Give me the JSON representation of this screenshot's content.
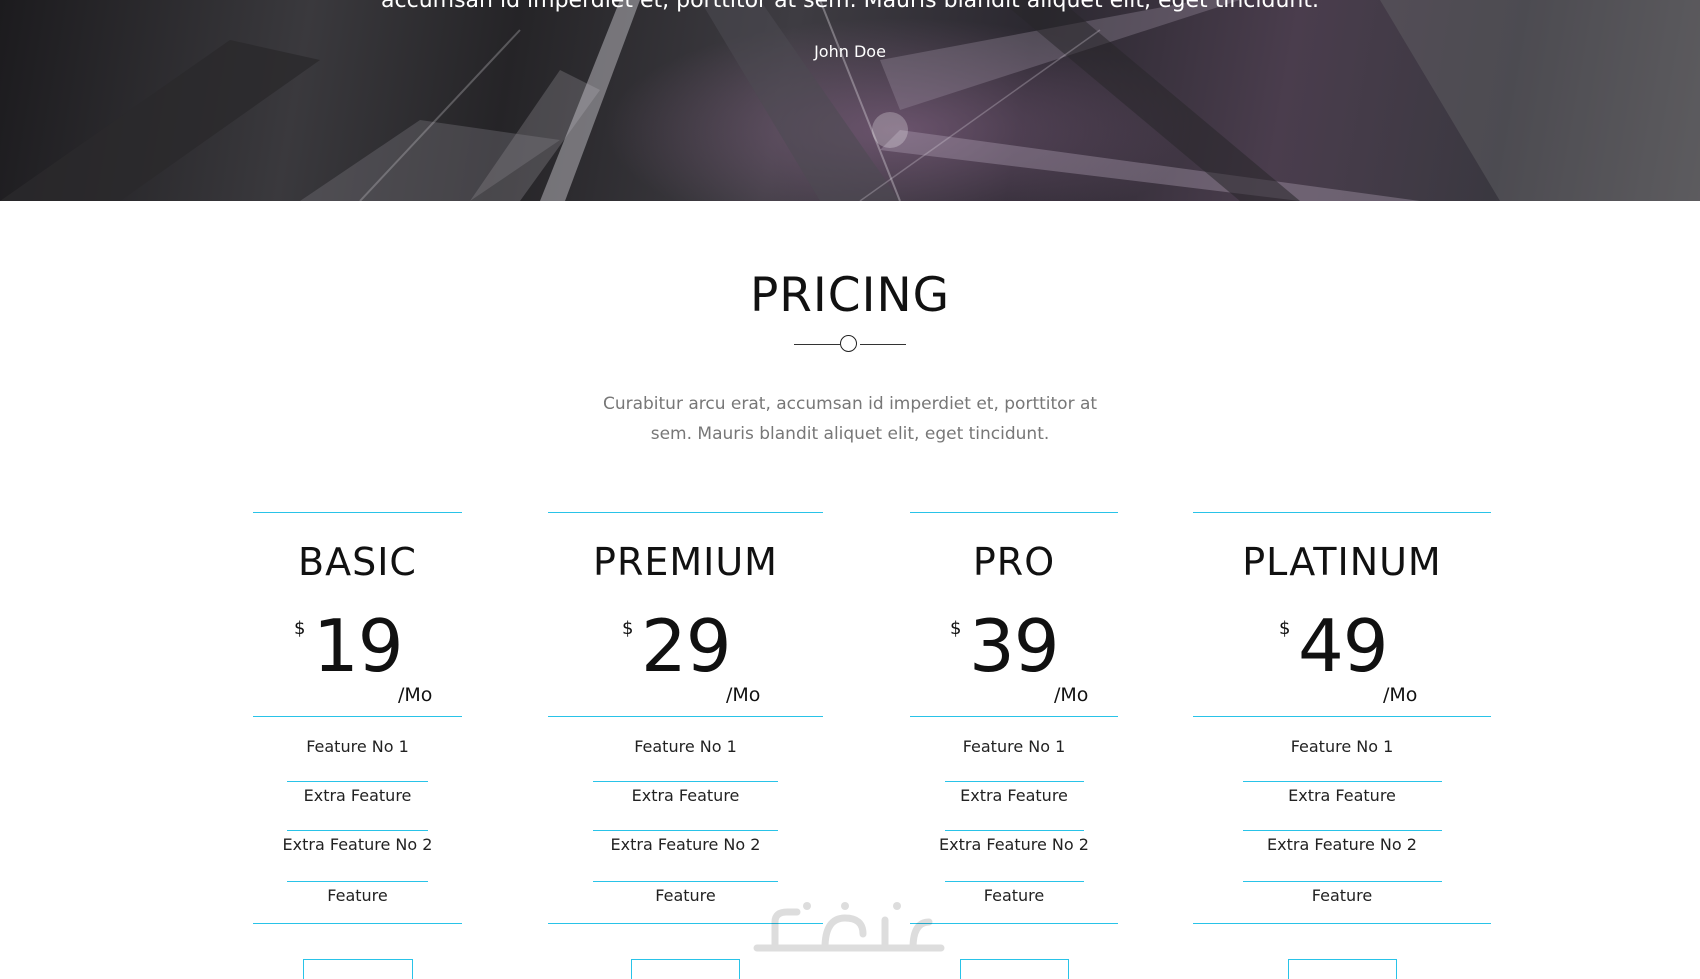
{
  "hero": {
    "quote": "accumsan id imperdiet et, porttitor at sem. Mauris blandit aliquet elit, eget tincidunt.",
    "open_quote": "“",
    "close_quote": "”",
    "author": "John Doe"
  },
  "pricing": {
    "title": "PRICING",
    "subtitle_line1": "Curabitur arcu erat, accumsan id imperdiet et, porttitor at",
    "subtitle_line2": "sem. Mauris blandit aliquet elit, eget tincidunt.",
    "plans": [
      {
        "name": "BASIC",
        "currency": "$",
        "amount": "19",
        "per": "/Mo",
        "features": [
          "Feature No 1",
          "Extra Feature",
          "Extra Feature No 2",
          "Feature"
        ]
      },
      {
        "name": "PREMIUM",
        "currency": "$",
        "amount": "29",
        "per": "/Mo",
        "features": [
          "Feature No 1",
          "Extra Feature",
          "Extra Feature No 2",
          "Feature"
        ]
      },
      {
        "name": "PRO",
        "currency": "$",
        "amount": "39",
        "per": "/Mo",
        "features": [
          "Feature No 1",
          "Extra Feature",
          "Extra Feature No 2",
          "Feature"
        ]
      },
      {
        "name": "PLATINUM",
        "currency": "$",
        "amount": "49",
        "per": "/Mo",
        "features": [
          "Feature No 1",
          "Extra Feature",
          "Extra Feature No 2",
          "Feature"
        ]
      }
    ]
  },
  "colors": {
    "accent": "#29c3e8",
    "text": "#111111",
    "muted": "#777777"
  },
  "watermark": {
    "icon": "khamsat-logo-icon"
  }
}
